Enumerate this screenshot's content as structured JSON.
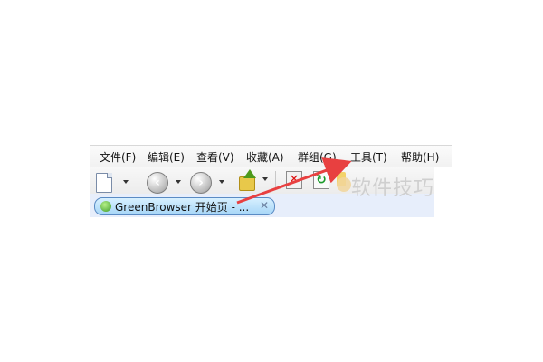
{
  "menu": {
    "file": "文件(F)",
    "edit": "编辑(E)",
    "view": "查看(V)",
    "favorites": "收藏(A)",
    "group": "群组(G)",
    "tools": "工具(T)",
    "help": "帮助(H)"
  },
  "tab": {
    "title": "GreenBrowser 开始页 - ...",
    "close": "✕"
  },
  "watermark": {
    "text": "软件技巧"
  },
  "icons": {
    "new": "new-document-icon",
    "back": "back-arrow-icon",
    "forward": "forward-arrow-icon",
    "up": "up-folder-icon",
    "stop": "stop-icon",
    "refresh": "refresh-icon",
    "home": "home-icon"
  },
  "colors": {
    "accent_arrow": "#e84040",
    "tab_border": "#5a8bc4"
  }
}
